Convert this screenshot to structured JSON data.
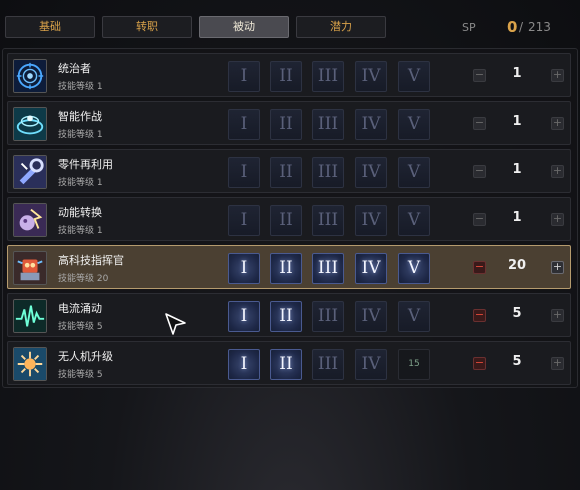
{
  "tabs": [
    {
      "label": "基础",
      "active": false
    },
    {
      "label": "转职",
      "active": false
    },
    {
      "label": "被动",
      "active": true
    },
    {
      "label": "潜力",
      "active": false
    }
  ],
  "sp": {
    "label": "SP",
    "current": "0",
    "separator": "/",
    "max": "213"
  },
  "level_prefix": "技能等级",
  "tiers": [
    "I",
    "II",
    "III",
    "IV",
    "V"
  ],
  "skills": [
    {
      "name": "统治者",
      "level_text": "技能等级 1",
      "value": "1",
      "tiers_unlocked": 0,
      "icon": "ruler-emblem-icon"
    },
    {
      "name": "智能作战",
      "level_text": "技能等级 1",
      "value": "1",
      "tiers_unlocked": 0,
      "icon": "smart-combat-icon"
    },
    {
      "name": "零件再利用",
      "level_text": "技能等级 1",
      "value": "1",
      "tiers_unlocked": 0,
      "icon": "parts-reuse-icon"
    },
    {
      "name": "动能转换",
      "level_text": "技能等级 1",
      "value": "1",
      "tiers_unlocked": 0,
      "icon": "kinetic-conversion-icon"
    },
    {
      "name": "高科技指挥官",
      "level_text": "技能等级 20",
      "value": "20",
      "tiers_unlocked": 5,
      "icon": "hightech-commander-icon"
    },
    {
      "name": "电流涌动",
      "level_text": "技能等级 5",
      "value": "5",
      "tiers_unlocked": 2,
      "icon": "current-surge-icon"
    },
    {
      "name": "无人机升级",
      "level_text": "技能等级 5",
      "value": "5",
      "tiers_unlocked": 2,
      "icon": "drone-upgrade-icon",
      "locked_tier_label": "15"
    }
  ],
  "colors": {
    "accent": "#d9a24a",
    "highlight_row": "#4b4032",
    "tier_active": "#2a3660"
  }
}
